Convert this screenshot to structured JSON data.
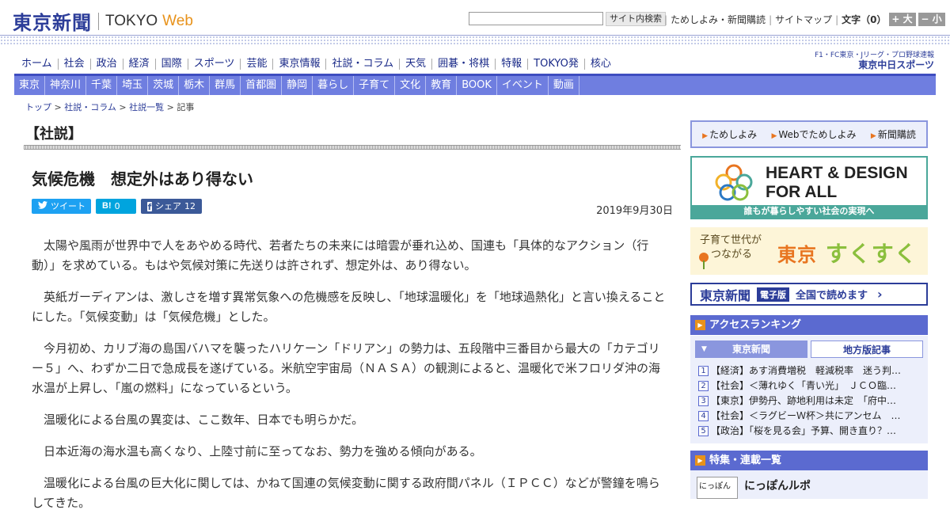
{
  "header": {
    "logo_kanji": "東京新聞",
    "logo_tokyo": "TOKYO",
    "logo_web": "Web",
    "search_button": "サイト内検索",
    "links": [
      "ためしよみ・新聞購読",
      "サイトマップ"
    ],
    "text_size_label": "文字（0）",
    "size_up": "+ 大",
    "size_down": "− 小"
  },
  "nav_main": [
    "ホーム",
    "社会",
    "政治",
    "経済",
    "国際",
    "スポーツ",
    "芸能",
    "東京情報",
    "社説・コラム",
    "天気",
    "囲碁・将棋",
    "特報",
    "TOKYO発",
    "核心"
  ],
  "sports_banner": {
    "line1": "F1・FC東京・Jリーグ・プロ野球速報",
    "line2": "東京中日スポーツ"
  },
  "nav_regional": [
    "東京",
    "神奈川",
    "千葉",
    "埼玉",
    "茨城",
    "栃木",
    "群馬",
    "首都圏",
    "静岡",
    "暮らし",
    "子育て",
    "文化",
    "教育",
    "BOOK",
    "イベント",
    "動画"
  ],
  "breadcrumb": [
    "トップ",
    "社説・コラム",
    "社説一覧",
    "記事"
  ],
  "article": {
    "section": "【社説】",
    "title": "気候危機　想定外はあり得ない",
    "date": "2019年9月30日",
    "social": {
      "tweet": "ツイート",
      "hatena_count": "0",
      "share": "シェア",
      "share_count": "12"
    },
    "paragraphs": [
      "太陽や風雨が世界中で人をあやめる時代、若者たちの未来には暗雲が垂れ込め、国連も「具体的なアクション（行動）」を求めている。もはや気候対策に先送りは許されず、想定外は、あり得ない。",
      "英紙ガーディアンは、激しさを増す異常気象への危機感を反映し、「地球温暖化」を「地球過熱化」と言い換えることにした。「気候変動」は「気候危機」とした。",
      "今月初め、カリブ海の島国バハマを襲ったハリケーン「ドリアン」の勢力は、五段階中三番目から最大の「カテゴリー５」へ、わずか二日で急成長を遂げている。米航空宇宙局（ＮＡＳＡ）の観測によると、温暖化で米フロリダ沖の海水温が上昇し、「嵐の燃料」になっているという。",
      "温暖化による台風の異変は、ここ数年、日本でも明らかだ。",
      "日本近海の海水温も高くなり、上陸寸前に至ってなお、勢力を強める傾向がある。",
      "温暖化による台風の巨大化に関しては、かねて国連の気候変動に関する政府間パネル（ＩＰＣＣ）などが警鐘を鳴らしてきた。"
    ]
  },
  "sidebar": {
    "trial_links": [
      "ためしよみ",
      "Webでためしよみ",
      "新聞購読"
    ],
    "hdfa_line1": "HEART & DESIGN",
    "hdfa_line2": "FOR ALL",
    "hdfa_caption": "誰もが暮らしやすい社会の実現へ",
    "sukusuku_small1": "子育て世代が",
    "sukusuku_small2": "つながる",
    "sukusuku_tokyo": "東京",
    "sukusuku_big": "すくすく",
    "denshi_logo": "東京新聞",
    "denshi_tag": "電子版",
    "denshi_msg": "全国で読めます",
    "ranking_title": "アクセスランキング",
    "ranking_tabs": [
      "東京新聞",
      "地方版記事"
    ],
    "ranking": [
      {
        "num": "1",
        "text": "【経済】あす消費増税　軽減税率　迷う判…"
      },
      {
        "num": "2",
        "text": "【社会】＜薄れゆく「青い光」　ＪＣＯ臨…"
      },
      {
        "num": "3",
        "text": "【東京】伊勢丹、跡地利用は未定　「府中…"
      },
      {
        "num": "4",
        "text": "【社会】＜ラグビーＷ杯＞共にアンセム　…"
      },
      {
        "num": "5",
        "text": "【政治】「桜を見る会」予算、開き直り？…"
      }
    ],
    "features_title": "特集・連載一覧",
    "features_thumb": "にっぽん",
    "features_item": "にっぽんルポ"
  }
}
